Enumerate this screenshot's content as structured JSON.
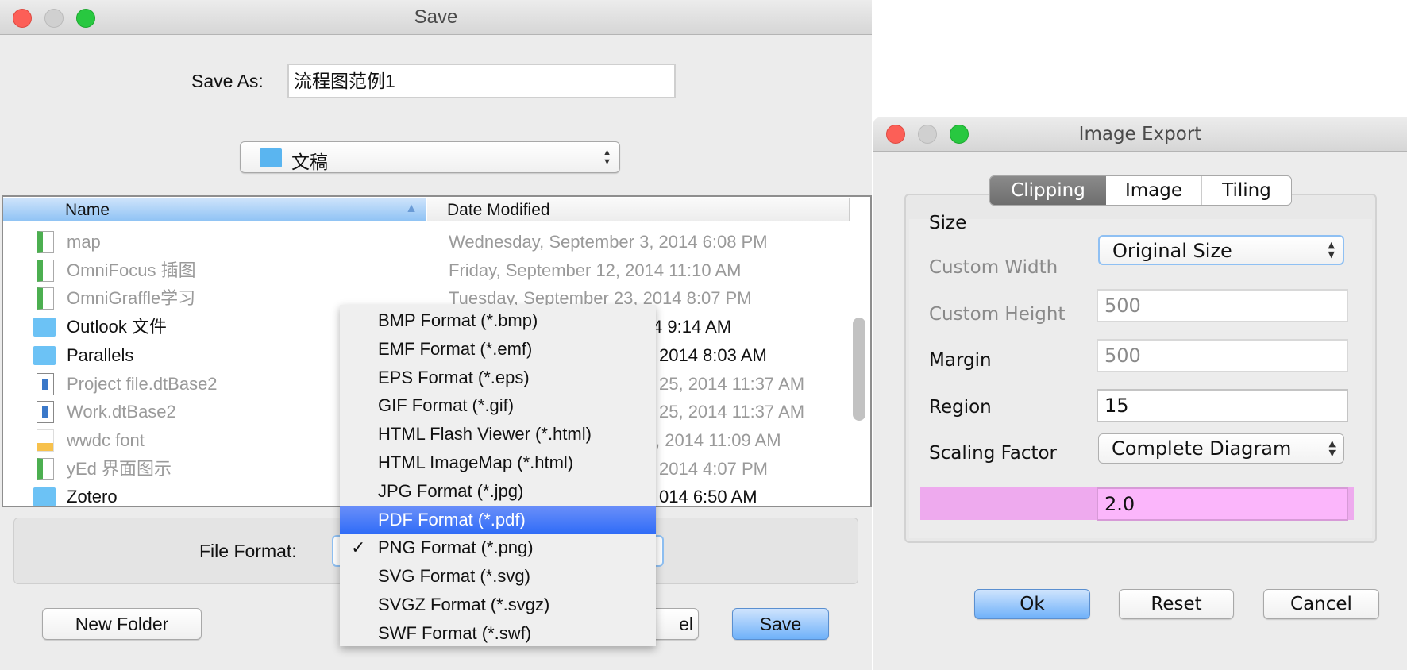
{
  "save_dialog": {
    "title": "Save",
    "save_as_label": "Save As:",
    "save_as_value": "流程图范例1",
    "folder": "文稿",
    "columns": {
      "name": "Name",
      "date": "Date Modified"
    },
    "files": [
      {
        "name": "map",
        "date": "Wednesday, September 3, 2014 6:08 PM",
        "icon": "omnigraffle-file-icon",
        "enabled": false
      },
      {
        "name": "OmniFocus 插图",
        "date": "Friday, September 12, 2014 11:10 AM",
        "icon": "omnigraffle-file-icon",
        "enabled": false
      },
      {
        "name": "OmniGraffle学习",
        "date": "Tuesday, September 23, 2014 8:07 PM",
        "icon": "omnigraffle-file-icon",
        "enabled": false
      },
      {
        "name": "Outlook 文件",
        "date": "4 9:14 AM",
        "icon": "folder-icon",
        "enabled": true
      },
      {
        "name": "Parallels",
        "date": "2014 8:03 AM",
        "icon": "folder-icon",
        "enabled": true
      },
      {
        "name": "Project file.dtBase2",
        "date": "25, 2014 11:37 AM",
        "icon": "document-icon",
        "enabled": false
      },
      {
        "name": "Work.dtBase2",
        "date": "25, 2014 11:37 AM",
        "icon": "document-icon",
        "enabled": false
      },
      {
        "name": "wwdc font",
        "date": ", 2014 11:09 AM",
        "icon": "font-file-icon",
        "enabled": false
      },
      {
        "name": "yEd 界面图示",
        "date": "2014 4:07 PM",
        "icon": "omnigraffle-file-icon",
        "enabled": false
      },
      {
        "name": "Zotero",
        "date": "014 6:50 AM",
        "icon": "folder-icon",
        "enabled": true
      }
    ],
    "file_format_label": "File Format:",
    "format_options": [
      "BMP Format (*.bmp)",
      "EMF Format (*.emf)",
      "EPS Format (*.eps)",
      "GIF Format (*.gif)",
      "HTML Flash Viewer (*.html)",
      "HTML ImageMap (*.html)",
      "JPG Format (*.jpg)",
      "PDF Format (*.pdf)",
      "PNG Format (*.png)",
      "SVG Format (*.svg)",
      "SVGZ Format (*.svgz)",
      "SWF Format (*.swf)"
    ],
    "highlighted_format": "PDF Format (*.pdf)",
    "checked_format": "PNG Format (*.png)",
    "check_mark": "✓",
    "new_folder_label": "New Folder",
    "cancel_label_visible": "el",
    "save_label": "Save"
  },
  "export_dialog": {
    "title": "Image Export",
    "tabs": [
      "Clipping",
      "Image",
      "Tiling"
    ],
    "active_tab": "Clipping",
    "size_label": "Size",
    "size_value": "Original Size",
    "custom_width_label": "Custom Width",
    "custom_width_value": "500",
    "custom_height_label": "Custom Height",
    "custom_height_value": "500",
    "margin_label": "Margin",
    "margin_value": "15",
    "region_label": "Region",
    "region_value": "Complete Diagram",
    "scaling_label": "Scaling Factor",
    "scaling_value": "2.0",
    "ok_label": "Ok",
    "reset_label": "Reset",
    "cancel_label": "Cancel",
    "highlight_color": "#fbb6fb"
  }
}
